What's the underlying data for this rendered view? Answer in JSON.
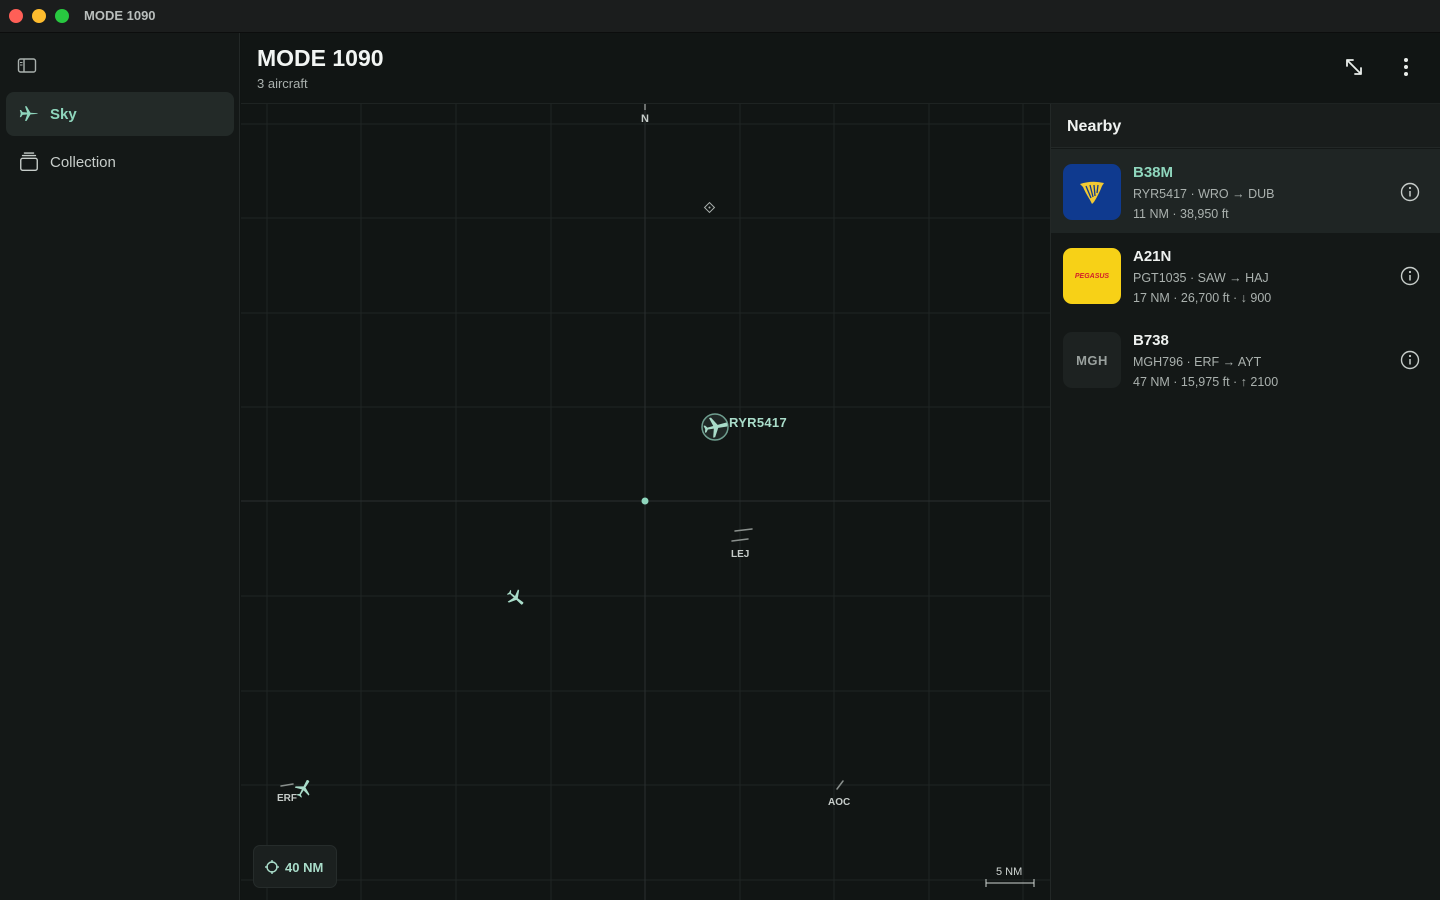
{
  "window": {
    "title": "MODE 1090"
  },
  "sidebar": {
    "items": [
      {
        "label": "Sky",
        "icon": "airplane-icon",
        "active": true
      },
      {
        "label": "Collection",
        "icon": "collection-stack-icon",
        "active": false
      }
    ]
  },
  "header": {
    "title": "MODE 1090",
    "subtitle": "3 aircraft"
  },
  "map": {
    "compass": "N",
    "selected_callsign": "RYR5417",
    "airports": [
      "LEJ",
      "ERF",
      "AOC"
    ],
    "range_label": "40 NM",
    "scale_label": "5 NM",
    "accent_color": "#8fd6bd"
  },
  "nearby": {
    "title": "Nearby",
    "aircraft": [
      {
        "type": "B38M",
        "route": "RYR5417 · WRO → DUB",
        "stats": "11 NM · 38,950 ft",
        "logo": "ryanair-harp-logo",
        "logo_bg": "#0f3a8f",
        "selected": true
      },
      {
        "type": "A21N",
        "route": "PGT1035 · SAW → HAJ",
        "stats": "17 NM · 26,700 ft · ↓ 900",
        "logo": "pegasus-logo",
        "logo_text": "PEGASUS",
        "logo_bg": "#f7d117",
        "selected": false
      },
      {
        "type": "B738",
        "route": "MGH796 · ERF → AYT",
        "stats": "47 NM · 15,975 ft · ↑ 2100",
        "logo": "text-logo",
        "logo_text": "MGH",
        "logo_bg": "#1d2221",
        "selected": false
      }
    ]
  }
}
